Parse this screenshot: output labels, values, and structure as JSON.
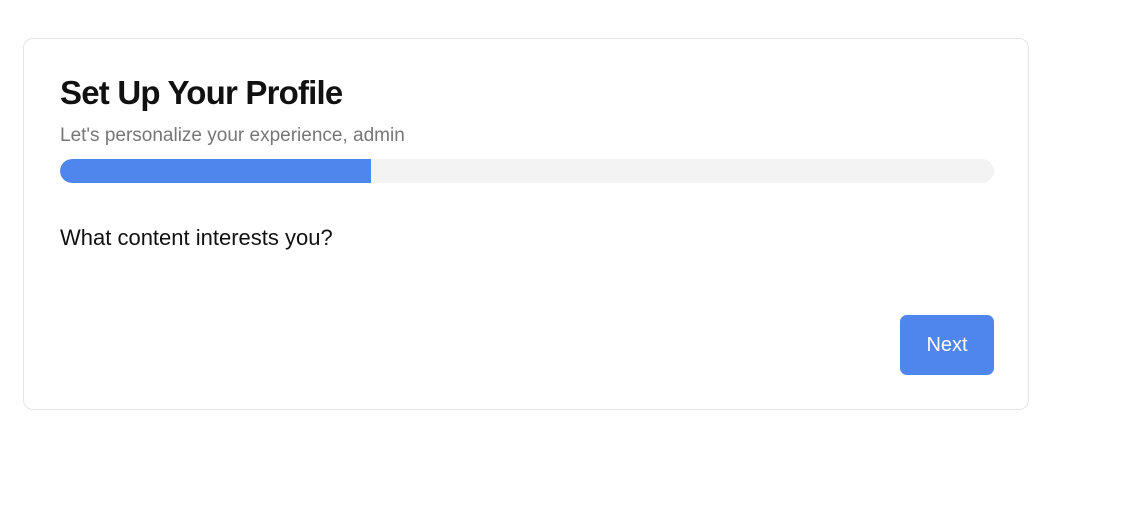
{
  "header": {
    "title": "Set Up Your Profile",
    "subtitle": "Let's personalize your experience, admin"
  },
  "progress": {
    "fraction": 0.333,
    "fill_color": "#4e86ee",
    "track_color": "#f3f3f3"
  },
  "question": {
    "text": "What content interests you?"
  },
  "actions": {
    "next_label": "Next",
    "button_color": "#4e86ee"
  }
}
